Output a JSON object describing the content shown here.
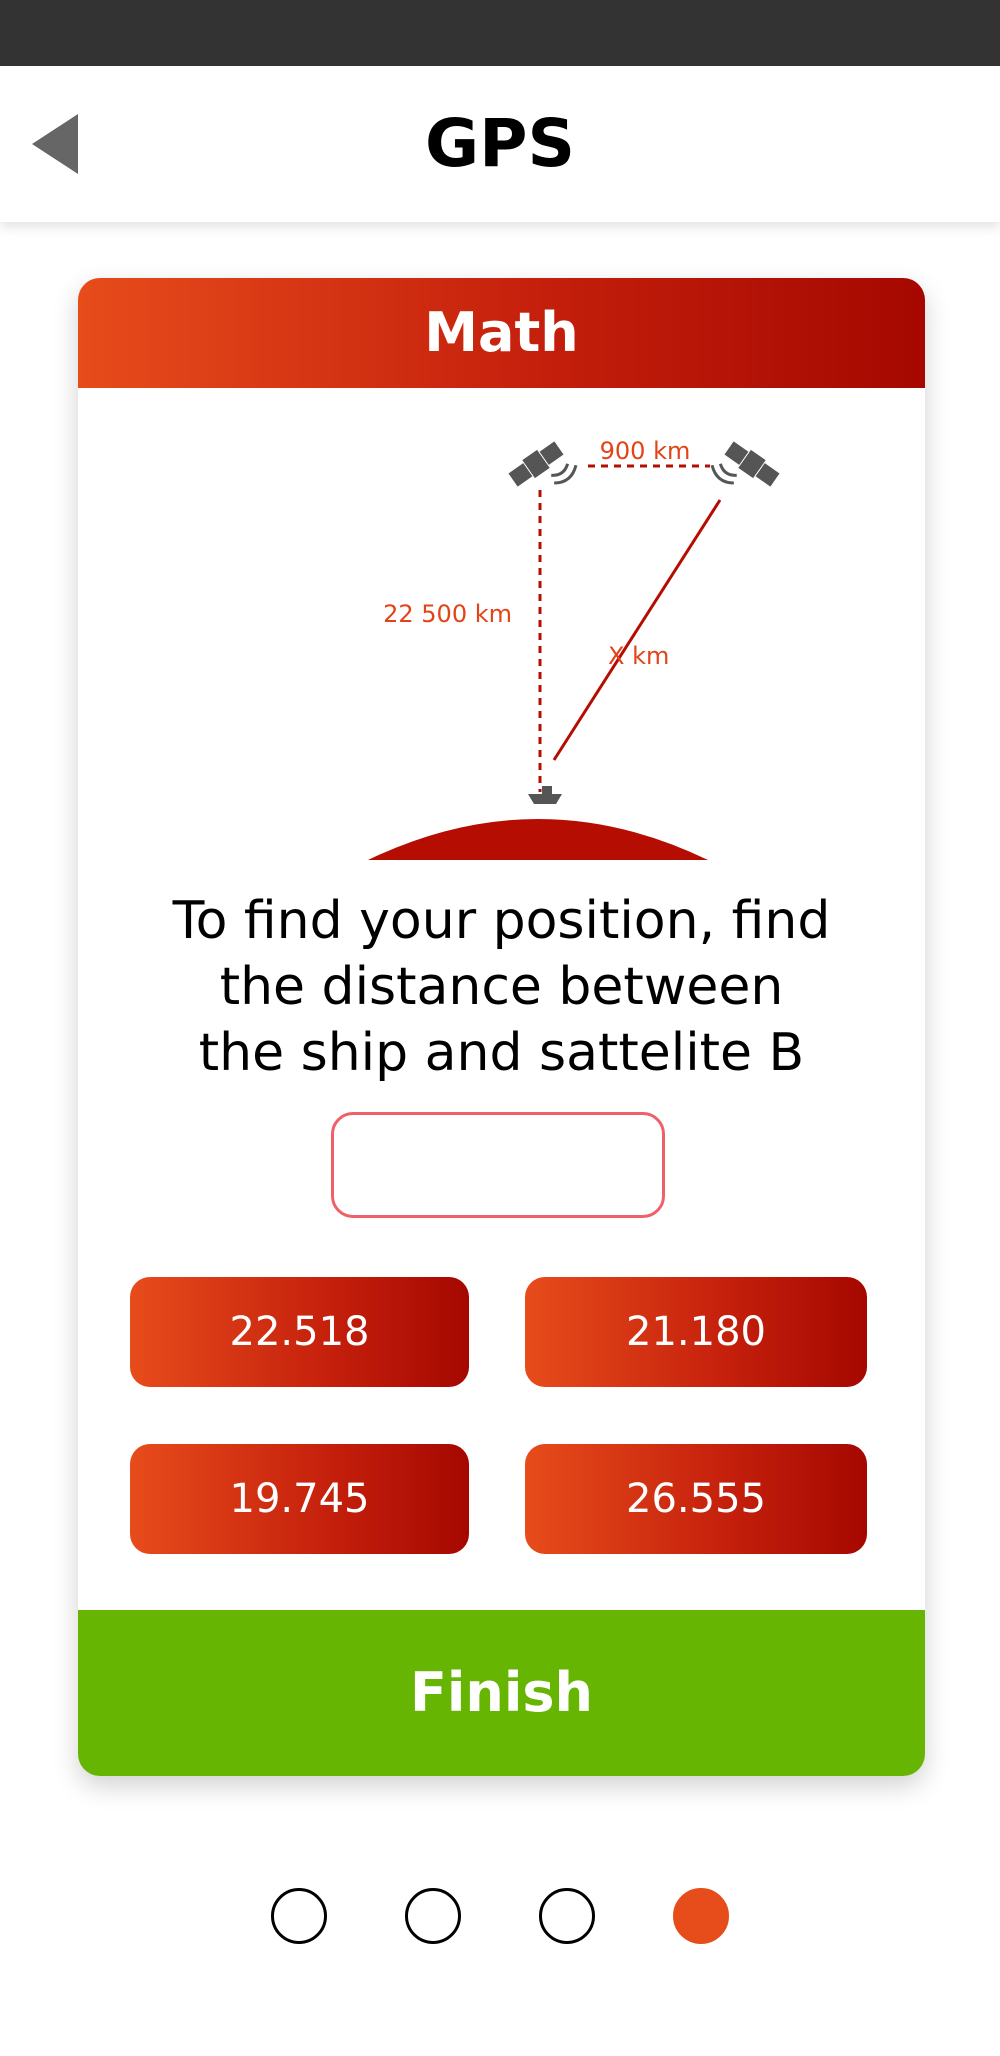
{
  "header": {
    "title": "GPS",
    "back_icon": "back-arrow-icon"
  },
  "card": {
    "title": "Math",
    "diagram": {
      "distance_ab": "900 km",
      "distance_a_ship": "22 500 km",
      "distance_b_ship": "X km"
    },
    "question_lines": [
      "To find your position, find",
      "the distance between",
      "the ship and sattelite B"
    ],
    "answer": {
      "value": "",
      "placeholder": ""
    },
    "options": [
      "22.518",
      "21.180",
      "19.745",
      "26.555"
    ],
    "finish_label": "Finish"
  },
  "pager": {
    "count": 4,
    "active_index": 3
  },
  "colors": {
    "status_bar": "#333333",
    "accent_start": "#e74c1b",
    "accent_end": "#a50800",
    "finish_green": "#67b503",
    "input_border": "#f0606a"
  }
}
